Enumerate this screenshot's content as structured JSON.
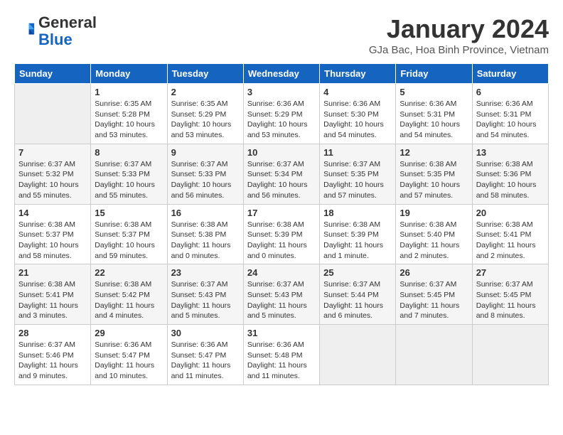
{
  "header": {
    "logo_line1": "General",
    "logo_line2": "Blue",
    "month": "January 2024",
    "location": "GJa Bac, Hoa Binh Province, Vietnam"
  },
  "weekdays": [
    "Sunday",
    "Monday",
    "Tuesday",
    "Wednesday",
    "Thursday",
    "Friday",
    "Saturday"
  ],
  "weeks": [
    [
      {
        "day": "",
        "info": ""
      },
      {
        "day": "1",
        "info": "Sunrise: 6:35 AM\nSunset: 5:28 PM\nDaylight: 10 hours\nand 53 minutes."
      },
      {
        "day": "2",
        "info": "Sunrise: 6:35 AM\nSunset: 5:29 PM\nDaylight: 10 hours\nand 53 minutes."
      },
      {
        "day": "3",
        "info": "Sunrise: 6:36 AM\nSunset: 5:29 PM\nDaylight: 10 hours\nand 53 minutes."
      },
      {
        "day": "4",
        "info": "Sunrise: 6:36 AM\nSunset: 5:30 PM\nDaylight: 10 hours\nand 54 minutes."
      },
      {
        "day": "5",
        "info": "Sunrise: 6:36 AM\nSunset: 5:31 PM\nDaylight: 10 hours\nand 54 minutes."
      },
      {
        "day": "6",
        "info": "Sunrise: 6:36 AM\nSunset: 5:31 PM\nDaylight: 10 hours\nand 54 minutes."
      }
    ],
    [
      {
        "day": "7",
        "info": "Sunrise: 6:37 AM\nSunset: 5:32 PM\nDaylight: 10 hours\nand 55 minutes."
      },
      {
        "day": "8",
        "info": "Sunrise: 6:37 AM\nSunset: 5:33 PM\nDaylight: 10 hours\nand 55 minutes."
      },
      {
        "day": "9",
        "info": "Sunrise: 6:37 AM\nSunset: 5:33 PM\nDaylight: 10 hours\nand 56 minutes."
      },
      {
        "day": "10",
        "info": "Sunrise: 6:37 AM\nSunset: 5:34 PM\nDaylight: 10 hours\nand 56 minutes."
      },
      {
        "day": "11",
        "info": "Sunrise: 6:37 AM\nSunset: 5:35 PM\nDaylight: 10 hours\nand 57 minutes."
      },
      {
        "day": "12",
        "info": "Sunrise: 6:38 AM\nSunset: 5:35 PM\nDaylight: 10 hours\nand 57 minutes."
      },
      {
        "day": "13",
        "info": "Sunrise: 6:38 AM\nSunset: 5:36 PM\nDaylight: 10 hours\nand 58 minutes."
      }
    ],
    [
      {
        "day": "14",
        "info": "Sunrise: 6:38 AM\nSunset: 5:37 PM\nDaylight: 10 hours\nand 58 minutes."
      },
      {
        "day": "15",
        "info": "Sunrise: 6:38 AM\nSunset: 5:37 PM\nDaylight: 10 hours\nand 59 minutes."
      },
      {
        "day": "16",
        "info": "Sunrise: 6:38 AM\nSunset: 5:38 PM\nDaylight: 11 hours\nand 0 minutes."
      },
      {
        "day": "17",
        "info": "Sunrise: 6:38 AM\nSunset: 5:39 PM\nDaylight: 11 hours\nand 0 minutes."
      },
      {
        "day": "18",
        "info": "Sunrise: 6:38 AM\nSunset: 5:39 PM\nDaylight: 11 hours\nand 1 minute."
      },
      {
        "day": "19",
        "info": "Sunrise: 6:38 AM\nSunset: 5:40 PM\nDaylight: 11 hours\nand 2 minutes."
      },
      {
        "day": "20",
        "info": "Sunrise: 6:38 AM\nSunset: 5:41 PM\nDaylight: 11 hours\nand 2 minutes."
      }
    ],
    [
      {
        "day": "21",
        "info": "Sunrise: 6:38 AM\nSunset: 5:41 PM\nDaylight: 11 hours\nand 3 minutes."
      },
      {
        "day": "22",
        "info": "Sunrise: 6:38 AM\nSunset: 5:42 PM\nDaylight: 11 hours\nand 4 minutes."
      },
      {
        "day": "23",
        "info": "Sunrise: 6:37 AM\nSunset: 5:43 PM\nDaylight: 11 hours\nand 5 minutes."
      },
      {
        "day": "24",
        "info": "Sunrise: 6:37 AM\nSunset: 5:43 PM\nDaylight: 11 hours\nand 5 minutes."
      },
      {
        "day": "25",
        "info": "Sunrise: 6:37 AM\nSunset: 5:44 PM\nDaylight: 11 hours\nand 6 minutes."
      },
      {
        "day": "26",
        "info": "Sunrise: 6:37 AM\nSunset: 5:45 PM\nDaylight: 11 hours\nand 7 minutes."
      },
      {
        "day": "27",
        "info": "Sunrise: 6:37 AM\nSunset: 5:45 PM\nDaylight: 11 hours\nand 8 minutes."
      }
    ],
    [
      {
        "day": "28",
        "info": "Sunrise: 6:37 AM\nSunset: 5:46 PM\nDaylight: 11 hours\nand 9 minutes."
      },
      {
        "day": "29",
        "info": "Sunrise: 6:36 AM\nSunset: 5:47 PM\nDaylight: 11 hours\nand 10 minutes."
      },
      {
        "day": "30",
        "info": "Sunrise: 6:36 AM\nSunset: 5:47 PM\nDaylight: 11 hours\nand 11 minutes."
      },
      {
        "day": "31",
        "info": "Sunrise: 6:36 AM\nSunset: 5:48 PM\nDaylight: 11 hours\nand 11 minutes."
      },
      {
        "day": "",
        "info": ""
      },
      {
        "day": "",
        "info": ""
      },
      {
        "day": "",
        "info": ""
      }
    ]
  ]
}
